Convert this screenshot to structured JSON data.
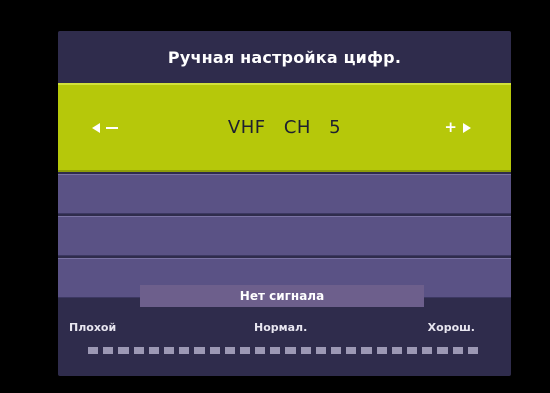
{
  "menu": {
    "title": "Ручная настройка цифр."
  },
  "channel": {
    "band": "VHF",
    "ch_label": "CH",
    "number": "5",
    "decrease_symbol": "−",
    "increase_symbol": "+"
  },
  "signal": {
    "status": "Нет сигнала",
    "scale_low": "Плохой",
    "scale_mid": "Нормал.",
    "scale_high": "Хорош.",
    "segments_total": 26,
    "level_fraction": 0.0
  },
  "colors": {
    "panel": "#2f2c4c",
    "selected_row": "#b6c80a",
    "empty_row": "#5a5285",
    "status_box": "#6d5f8c"
  }
}
